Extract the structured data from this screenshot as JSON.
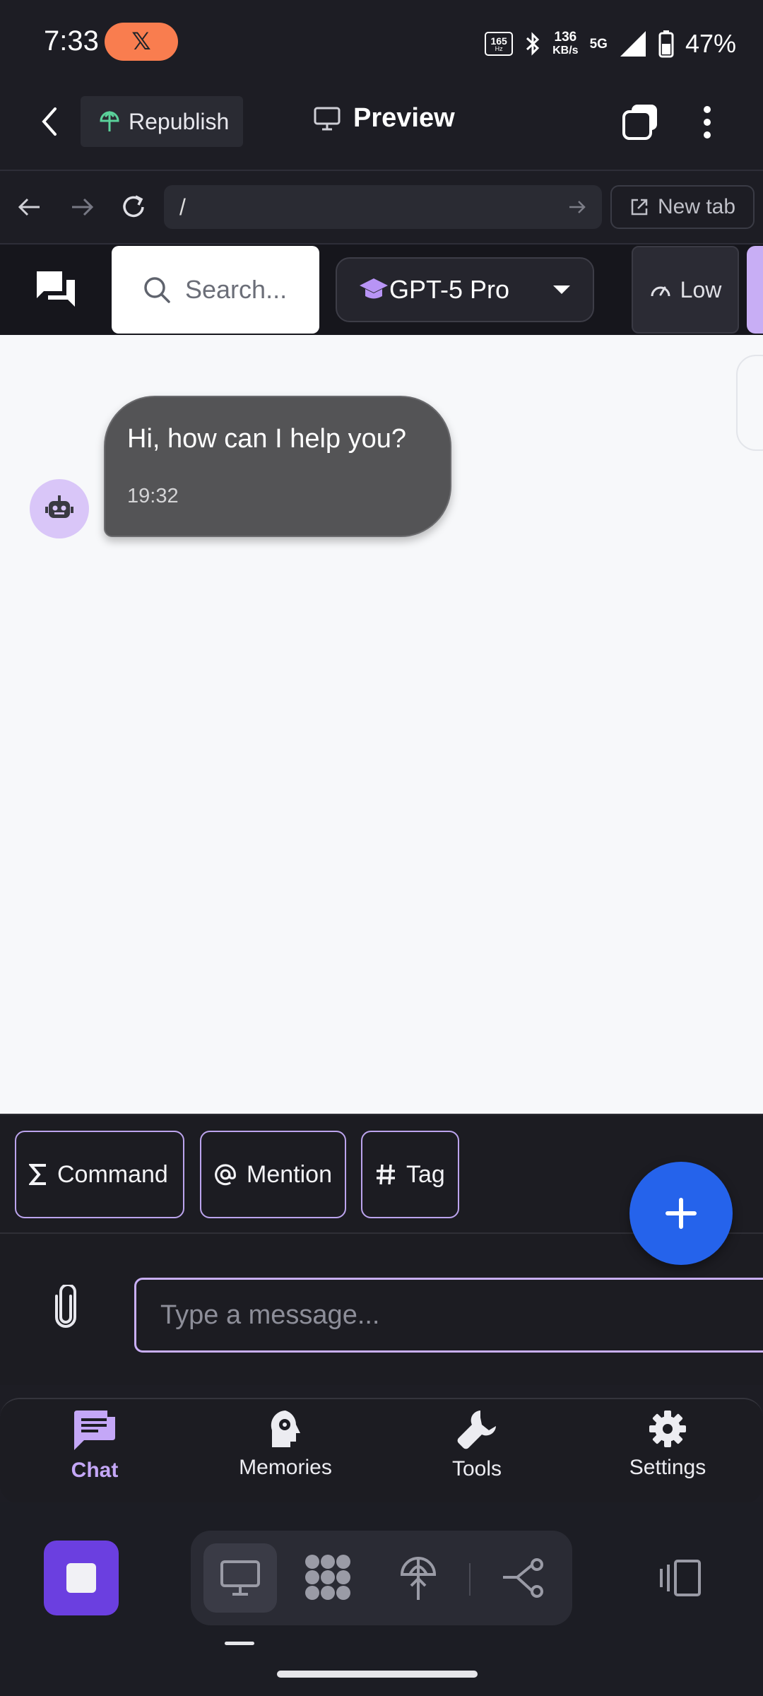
{
  "status": {
    "time": "7:33",
    "x_badge": "𝕏",
    "hz": "165",
    "hz_unit": "Hz",
    "net_speed": "136",
    "net_unit": "KB/s",
    "network": "5G",
    "battery": "47%"
  },
  "topbar": {
    "republish_label": "Republish",
    "preview_label": "Preview"
  },
  "browser": {
    "url": "/",
    "new_tab_label": "New tab"
  },
  "chat_toolbar": {
    "search_placeholder": "Search...",
    "model": "GPT-5 Pro",
    "effort": "Low"
  },
  "messages": [
    {
      "sender": "bot",
      "text": "Hi, how can I help you?",
      "time": "19:32"
    }
  ],
  "composer": {
    "chips": [
      "Command",
      "Mention",
      "Tag"
    ],
    "input_placeholder": "Type a message..."
  },
  "bottom_nav": {
    "items": [
      {
        "label": "Chat",
        "icon": "chat-icon",
        "active": true
      },
      {
        "label": "Memories",
        "icon": "brain-icon",
        "active": false
      },
      {
        "label": "Tools",
        "icon": "wrench-icon",
        "active": false
      },
      {
        "label": "Settings",
        "icon": "gear-icon",
        "active": false
      }
    ]
  },
  "colors": {
    "accent_purple": "#c4a7f7",
    "fab_blue": "#2563eb",
    "stop_purple": "#6b3fe0",
    "bubble_gray": "#545456"
  }
}
